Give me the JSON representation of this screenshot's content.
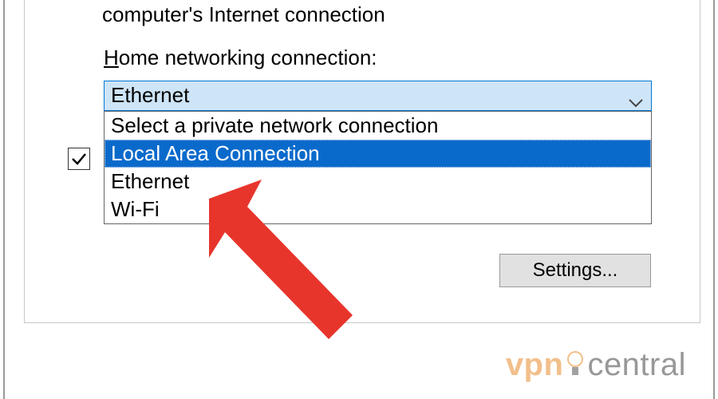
{
  "top_checkbox_text": "computer's Internet connection",
  "home_label_pre": "H",
  "home_label_rest": "ome networking connection:",
  "combo": {
    "selected": "Ethernet",
    "options": [
      {
        "label": "Select a private network connection",
        "selected": false
      },
      {
        "label": "Local Area Connection",
        "selected": true
      },
      {
        "label": "Ethernet",
        "selected": false
      },
      {
        "label": "Wi-Fi",
        "selected": false
      }
    ]
  },
  "checkbox2_checked": true,
  "settings_button": "Settings...",
  "watermark": {
    "left": "vpn",
    "right": "central"
  },
  "colors": {
    "accent": "#0a6acb",
    "arrow": "#e7352c"
  }
}
